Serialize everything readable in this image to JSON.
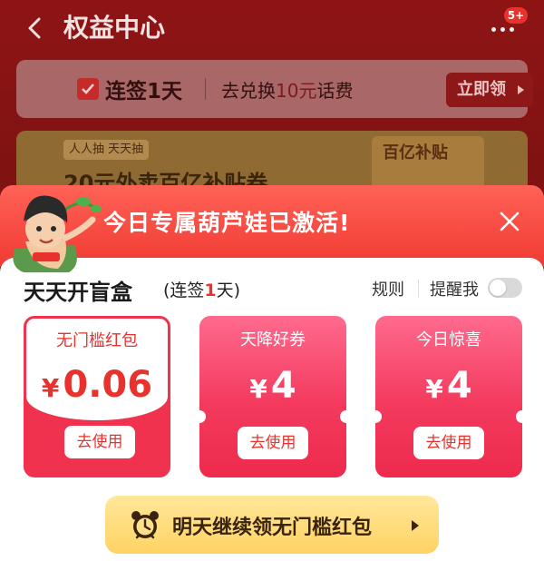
{
  "header": {
    "title": "权益中心",
    "more_badge": "5+"
  },
  "sign_card": {
    "label": "连签1天",
    "desc_prefix": "去兑换",
    "desc_highlight": "10元",
    "desc_suffix": "话费",
    "button": "立即领"
  },
  "promo_card": {
    "tag": "人人抽 天天抽",
    "text": "20元外卖百亿补贴券",
    "logo_text": "百亿补贴"
  },
  "popup": {
    "banner_title": "今日专属葫芦娃已激活!",
    "blind_box_title": "天天开盲盒",
    "streak_prefix": "(连签",
    "streak_num": "1",
    "streak_suffix": "天)",
    "rules": "规则",
    "remind": "提醒我",
    "remind_on": false,
    "coupons": [
      {
        "name": "无门槛红包",
        "currency": "¥",
        "amount": "0.06",
        "button": "去使用"
      },
      {
        "name": "天降好券",
        "currency": "¥",
        "amount": "4",
        "button": "去使用"
      },
      {
        "name": "今日惊喜",
        "currency": "¥",
        "amount": "4",
        "button": "去使用"
      }
    ],
    "cta": "明天继续领无门槛红包"
  },
  "colors": {
    "accent_red": "#e8322e",
    "cta_yellow": "#ffd363",
    "coupon_pink": "#f33a5d"
  }
}
